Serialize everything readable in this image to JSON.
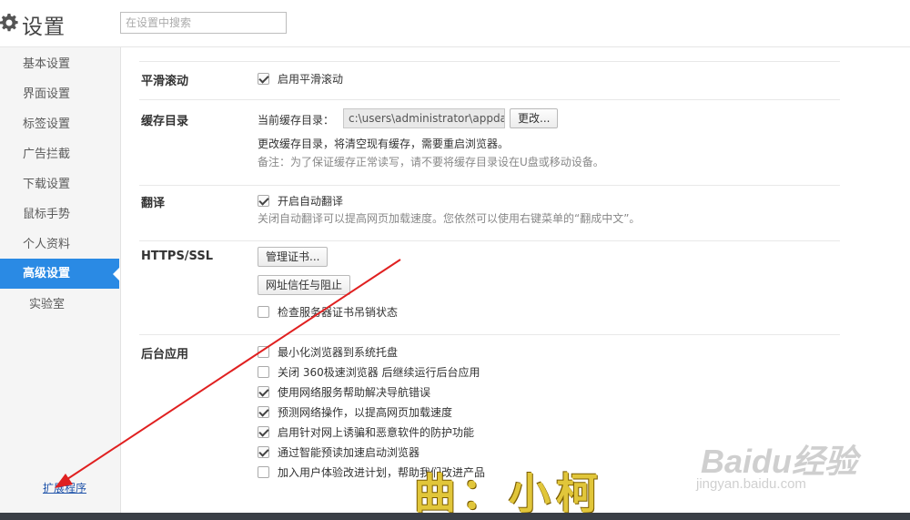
{
  "header": {
    "title": "设置",
    "search_placeholder": "在设置中搜索"
  },
  "sidebar": {
    "items": [
      {
        "label": "基本设置"
      },
      {
        "label": "界面设置"
      },
      {
        "label": "标签设置"
      },
      {
        "label": "广告拦截"
      },
      {
        "label": "下载设置"
      },
      {
        "label": "鼠标手势"
      },
      {
        "label": "个人资料"
      },
      {
        "label": "高级设置",
        "active": true
      },
      {
        "label": "实验室"
      }
    ],
    "extensions_link": "扩展程序"
  },
  "sections": {
    "smooth_scroll": {
      "title": "平滑滚动",
      "option": {
        "label": "启用平滑滚动",
        "checked": true
      }
    },
    "cache": {
      "title": "缓存目录",
      "current_label": "当前缓存目录：",
      "path_value": "c:\\users\\administrator\\appdata",
      "change_button": "更改...",
      "info": "更改缓存目录，将清空现有缓存，需要重启浏览器。",
      "note": "备注：为了保证缓存正常读写，请不要将缓存目录设在U盘或移动设备。"
    },
    "translate": {
      "title": "翻译",
      "option": {
        "label": "开启自动翻译",
        "checked": true
      },
      "note": "关闭自动翻译可以提高网页加载速度。您依然可以使用右键菜单的“翻成中文”。"
    },
    "https": {
      "title": "HTTPS/SSL",
      "manage_button": "管理证书...",
      "trust_button": "网址信任与阻止",
      "option": {
        "label": "检查服务器证书吊销状态",
        "checked": false
      }
    },
    "background": {
      "title": "后台应用",
      "options": [
        {
          "label": "最小化浏览器到系统托盘",
          "checked": false
        },
        {
          "label": "关闭 360极速浏览器 后继续运行后台应用",
          "checked": false
        },
        {
          "label": "使用网络服务帮助解决导航错误",
          "checked": true
        },
        {
          "label": "预测网络操作，以提高网页加载速度",
          "checked": true
        },
        {
          "label": "启用针对网上诱骗和恶意软件的防护功能",
          "checked": true
        },
        {
          "label": "通过智能预读加速启动浏览器",
          "checked": true
        },
        {
          "label": "加入用户体验改进计划，帮助我们改进产品",
          "checked": false
        }
      ]
    }
  },
  "overlay": {
    "watermark_text": "曲：小柯",
    "baidu_logo": "Baidu经验",
    "baidu_url": "jingyan.baidu.com",
    "arrow_color": "#e02020"
  }
}
